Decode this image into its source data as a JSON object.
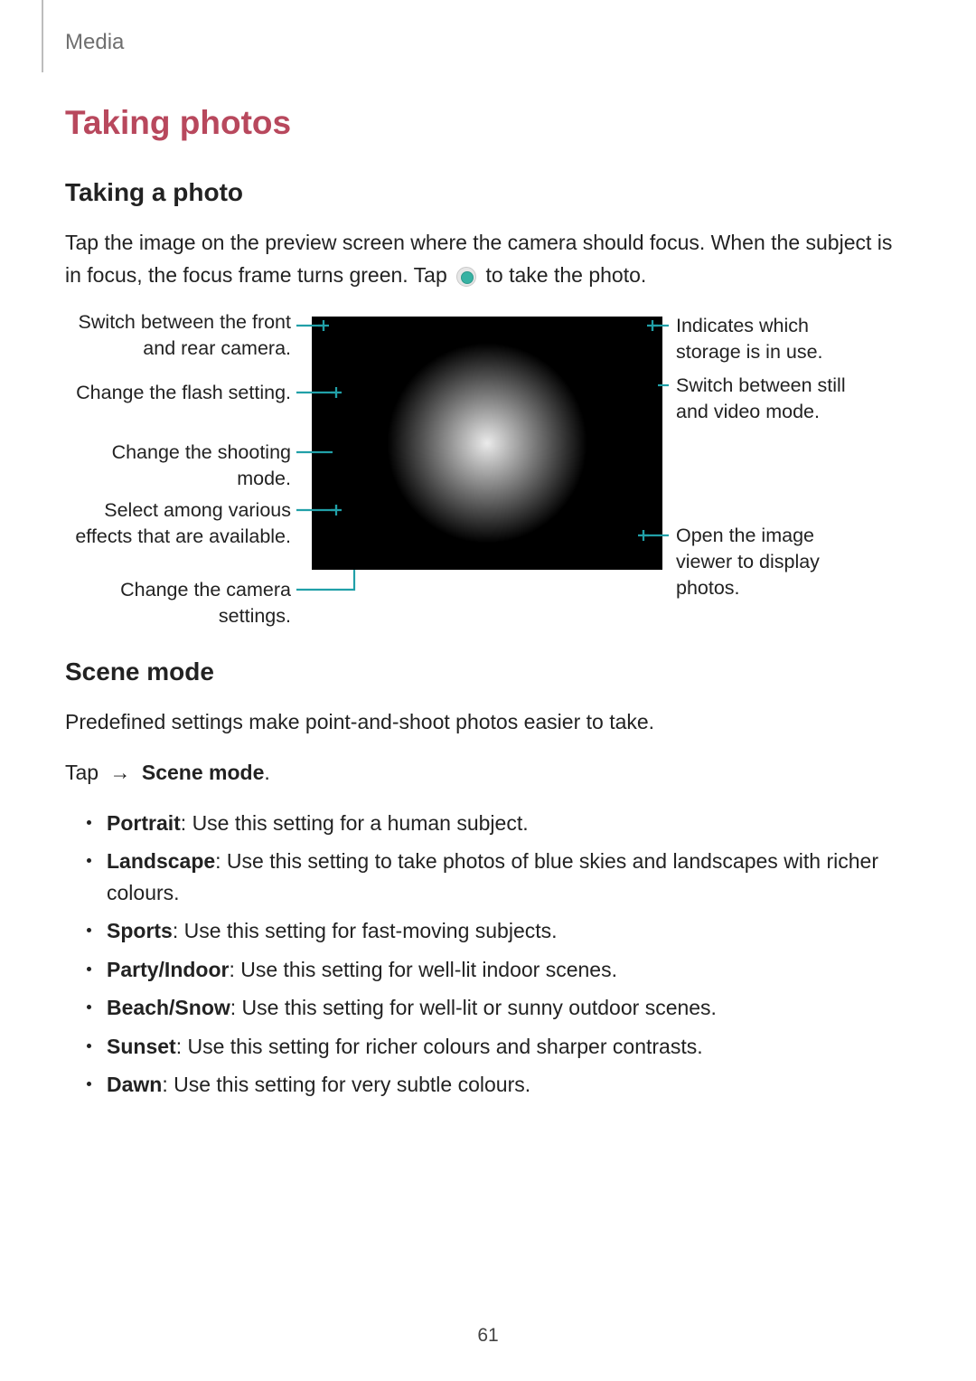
{
  "header": {
    "section": "Media"
  },
  "h1": "Taking photos",
  "photo": {
    "heading": "Taking a photo",
    "para_1a": "Tap the image on the preview screen where the camera should focus. When the subject is in focus, the focus frame turns green. Tap ",
    "para_1b": " to take the photo."
  },
  "callouts": {
    "left": [
      "Switch between the front and rear camera.",
      "Change the flash setting.",
      "Change the shooting mode.",
      "Select among various effects that are available.",
      "Change the camera settings."
    ],
    "right": [
      "Indicates which storage is in use.",
      "Switch between still and video mode.",
      "Open the image viewer to display photos."
    ]
  },
  "scene": {
    "heading": "Scene mode",
    "intro": "Predefined settings make point-and-shoot photos easier to take.",
    "tap_prefix": "Tap ",
    "arrow": "→",
    "tap_target": "Scene mode",
    "tap_suffix": ".",
    "items": [
      {
        "name": "Portrait",
        "desc": ": Use this setting for a human subject."
      },
      {
        "name": "Landscape",
        "desc": ": Use this setting to take photos of blue skies and landscapes with richer colours."
      },
      {
        "name": "Sports",
        "desc": ": Use this setting for fast-moving subjects."
      },
      {
        "name": "Party/Indoor",
        "desc": ": Use this setting for well-lit indoor scenes."
      },
      {
        "name": "Beach/Snow",
        "desc": ": Use this setting for well-lit or sunny outdoor scenes."
      },
      {
        "name": "Sunset",
        "desc": ": Use this setting for richer colours and sharper contrasts."
      },
      {
        "name": "Dawn",
        "desc": ": Use this setting for very subtle colours."
      }
    ]
  },
  "page_number": "61",
  "colors": {
    "heading": "#b8485d",
    "callout_stroke": "#21a0a8"
  }
}
